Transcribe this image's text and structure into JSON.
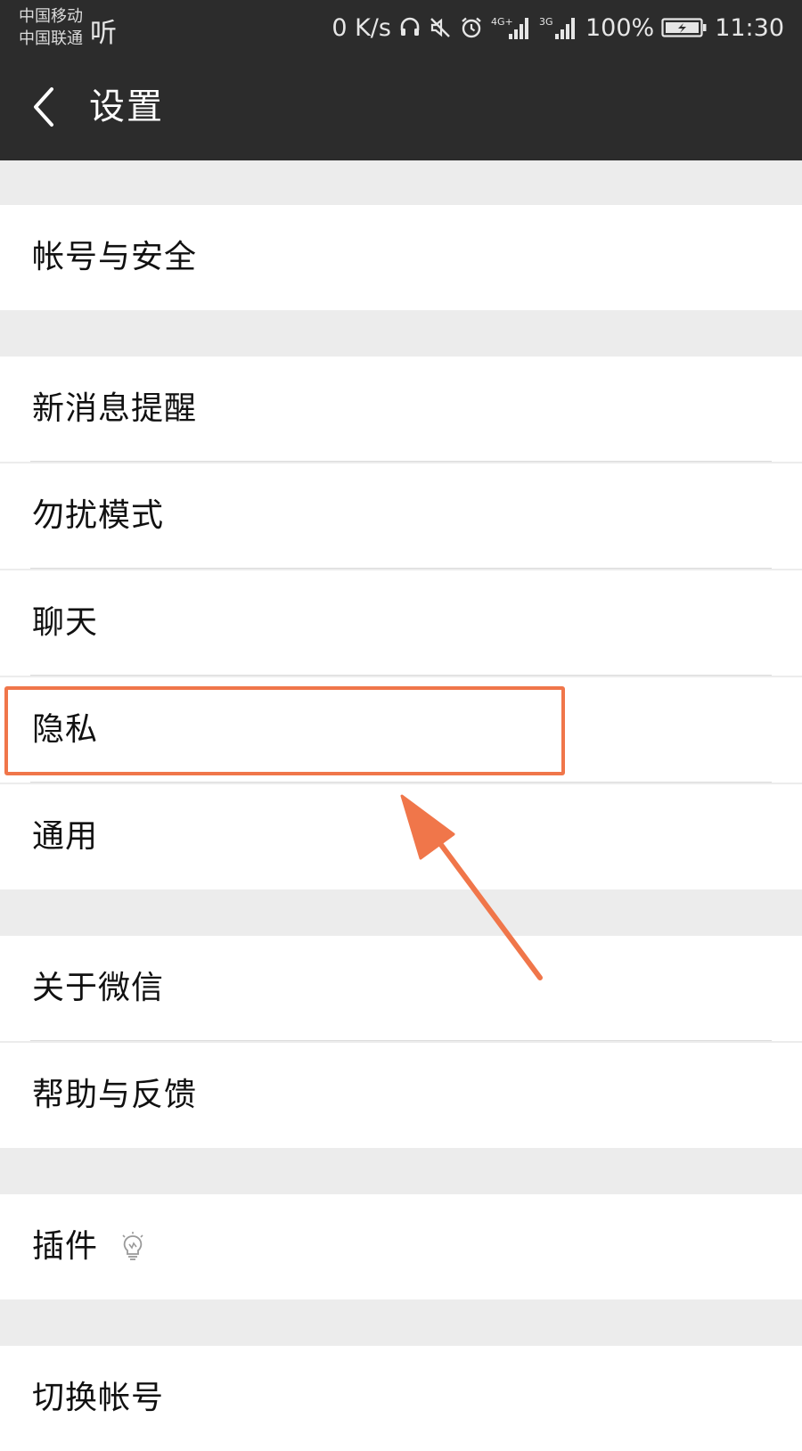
{
  "status_bar": {
    "carrier_1": "中国移动",
    "carrier_2": "中国联通",
    "listen_label": "听",
    "net_speed": "0 K/s",
    "battery": "100%",
    "time": "11:30",
    "net_4g": "4G+",
    "net_3g": "3G",
    "icons": [
      "headset-icon",
      "mute-icon",
      "alarm-icon",
      "signal-4g-icon",
      "signal-3g-icon",
      "battery-charging-icon"
    ]
  },
  "header": {
    "title": "设置",
    "back_icon": "chevron-left-icon"
  },
  "settings": {
    "account_security": "帐号与安全",
    "new_message_alert": "新消息提醒",
    "do_not_disturb": "勿扰模式",
    "chat": "聊天",
    "privacy": "隐私",
    "general": "通用",
    "about_wechat": "关于微信",
    "help_feedback": "帮助与反馈",
    "plugins": "插件",
    "plugins_icon": "lightbulb-icon",
    "switch_account": "切换帐号"
  },
  "annotation": {
    "color": "#f0764a",
    "target": "privacy"
  },
  "colors": {
    "bar": "#2c2c2c",
    "section_gap": "#ececec",
    "row": "#ffffff",
    "divider": "#dcdcdc"
  }
}
